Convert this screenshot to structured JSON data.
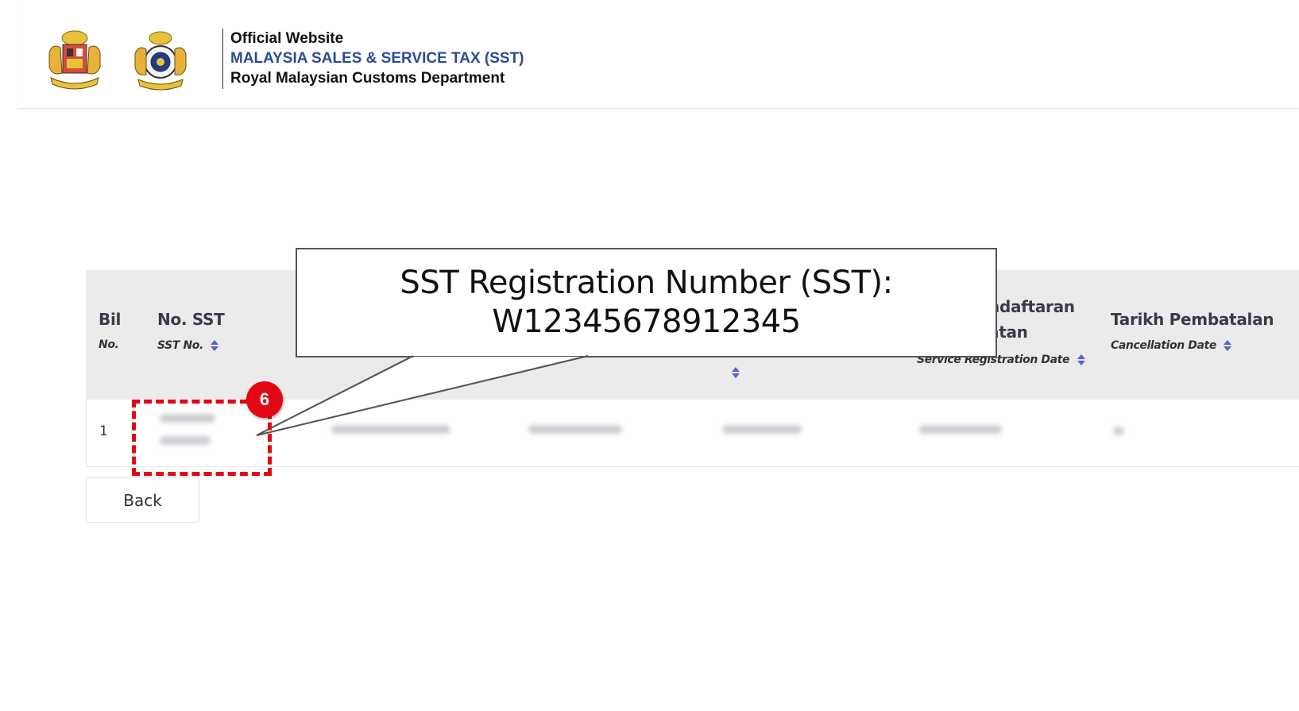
{
  "header": {
    "line1": "Official Website",
    "line2": "MALAYSIA SALES & SERVICE TAX (SST)",
    "line3": "Royal Malaysian Customs Department"
  },
  "table": {
    "columns": {
      "bil": {
        "main": "Bil",
        "sub": "No."
      },
      "sst": {
        "main": "No. SST",
        "sub": "SST No."
      },
      "service_reg": {
        "main_a": "ndaftaran",
        "main_b": "atan",
        "sub": "Service Registration Date"
      },
      "cancel": {
        "main": "Tarikh Pembatalan",
        "sub": "Cancellation Date"
      }
    },
    "rows": [
      {
        "bil": "1"
      }
    ]
  },
  "back_label": "Back",
  "callout": {
    "line1": "SST Registration Number (SST):",
    "line2": "W12345678912345"
  },
  "badge": "6",
  "colors": {
    "accent_red": "#e30613",
    "brand_blue": "#2d4a9a",
    "sort_icon": "#5b63c9",
    "table_header_bg": "#ebebeb"
  }
}
